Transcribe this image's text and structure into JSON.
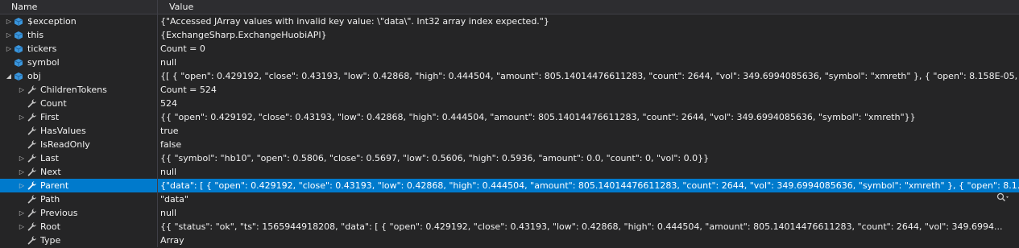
{
  "header": {
    "name": "Name",
    "value": "Value"
  },
  "rows": [
    {
      "name": "$exception",
      "value": "{\"Accessed JArray values with invalid key value: \\\"data\\\". Int32 array index expected.\"}",
      "depth": 0,
      "expander": "collapsed",
      "icon": "variable-cube-icon"
    },
    {
      "name": "this",
      "value": "{ExchangeSharp.ExchangeHuobiAPI}",
      "depth": 0,
      "expander": "collapsed",
      "icon": "variable-cube-icon"
    },
    {
      "name": "tickers",
      "value": "Count = 0",
      "depth": 0,
      "expander": "collapsed",
      "icon": "variable-cube-icon"
    },
    {
      "name": "symbol",
      "value": "null",
      "depth": 0,
      "expander": "none",
      "icon": "variable-cube-icon"
    },
    {
      "name": "obj",
      "value": "{[  {    \"open\": 0.429192,    \"close\": 0.43193,    \"low\": 0.42868,    \"high\": 0.444504,    \"amount\": 805.14014476611283,    \"count\": 2644,    \"vol\": 349.6994085636,    \"symbol\": \"xmreth\"  },  {    \"open\": 8.158E-05,",
      "depth": 0,
      "expander": "expanded",
      "icon": "variable-cube-icon"
    },
    {
      "name": "ChildrenTokens",
      "value": "Count = 524",
      "depth": 1,
      "expander": "collapsed",
      "icon": "property-wrench-icon"
    },
    {
      "name": "Count",
      "value": "524",
      "depth": 1,
      "expander": "none",
      "icon": "property-wrench-icon"
    },
    {
      "name": "First",
      "value": "{{  \"open\": 0.429192,  \"close\": 0.43193,  \"low\": 0.42868,  \"high\": 0.444504,  \"amount\": 805.14014476611283,  \"count\": 2644,  \"vol\": 349.6994085636,  \"symbol\": \"xmreth\"}}",
      "depth": 1,
      "expander": "collapsed",
      "icon": "property-wrench-icon"
    },
    {
      "name": "HasValues",
      "value": "true",
      "depth": 1,
      "expander": "none",
      "icon": "property-wrench-icon"
    },
    {
      "name": "IsReadOnly",
      "value": "false",
      "depth": 1,
      "expander": "none",
      "icon": "property-wrench-icon"
    },
    {
      "name": "Last",
      "value": "{{  \"symbol\": \"hb10\",  \"open\": 0.5806,  \"close\": 0.5697,  \"low\": 0.5606,  \"high\": 0.5936,  \"amount\": 0.0,  \"count\": 0,  \"vol\": 0.0}}",
      "depth": 1,
      "expander": "collapsed",
      "icon": "property-wrench-icon"
    },
    {
      "name": "Next",
      "value": "null",
      "depth": 1,
      "expander": "collapsed",
      "icon": "property-wrench-icon"
    },
    {
      "name": "Parent",
      "value": "{\"data\": [  {    \"open\": 0.429192,    \"close\": 0.43193,    \"low\": 0.42868,    \"high\": 0.444504,    \"amount\": 805.14014476611283,    \"count\": 2644,    \"vol\": 349.6994085636,    \"symbol\": \"xmreth\"  },  {    \"open\": 8.1...",
      "depth": 1,
      "expander": "collapsed",
      "icon": "property-wrench-icon",
      "selected": true
    },
    {
      "name": "Path",
      "value": "\"data\"",
      "depth": 1,
      "expander": "none",
      "icon": "property-wrench-icon"
    },
    {
      "name": "Previous",
      "value": "null",
      "depth": 1,
      "expander": "collapsed",
      "icon": "property-wrench-icon"
    },
    {
      "name": "Root",
      "value": "{{  \"status\": \"ok\",  \"ts\": 1565944918208,  \"data\": [    {      \"open\": 0.429192,      \"close\": 0.43193,      \"low\": 0.42868,      \"high\": 0.444504,      \"amount\": 805.14014476611283,      \"count\": 2644,      \"vol\": 349.6994...",
      "depth": 1,
      "expander": "collapsed",
      "icon": "property-wrench-icon"
    },
    {
      "name": "Type",
      "value": "Array",
      "depth": 1,
      "expander": "none",
      "icon": "property-wrench-icon"
    }
  ],
  "colors": {
    "background": "#252526",
    "selection": "#007acc",
    "cube": "#3a96dd",
    "wrench": "#c8c8c8"
  },
  "magnifier_icon": "search-magnifier-icon"
}
